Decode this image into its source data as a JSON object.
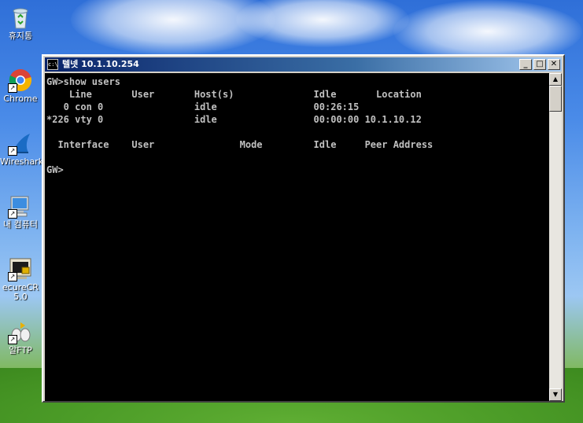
{
  "desktop": {
    "icons": [
      {
        "label": "휴지통",
        "icon": "recycle-bin-icon"
      },
      {
        "label": "Chrome",
        "icon": "chrome-icon"
      },
      {
        "label": "Wireshark",
        "icon": "wireshark-icon"
      },
      {
        "label": "내 컴퓨터",
        "icon": "my-computer-icon"
      },
      {
        "label": "ecureCR\n5.0",
        "icon": "securecrt-icon"
      },
      {
        "label": "알FTP",
        "icon": "alftp-icon"
      }
    ]
  },
  "window": {
    "title": "텔넷 10.1.10.254",
    "title_icon_text": "c:\\",
    "buttons": {
      "minimize": "_",
      "maximize": "□",
      "close": "✕"
    }
  },
  "terminal": {
    "lines": [
      "GW>show users",
      "    Line       User       Host(s)              Idle       Location",
      "   0 con 0                idle                 00:26:15",
      "*226 vty 0                idle                 00:00:00 10.1.10.12",
      "",
      "  Interface    User               Mode         Idle     Peer Address",
      "",
      "GW>"
    ]
  }
}
